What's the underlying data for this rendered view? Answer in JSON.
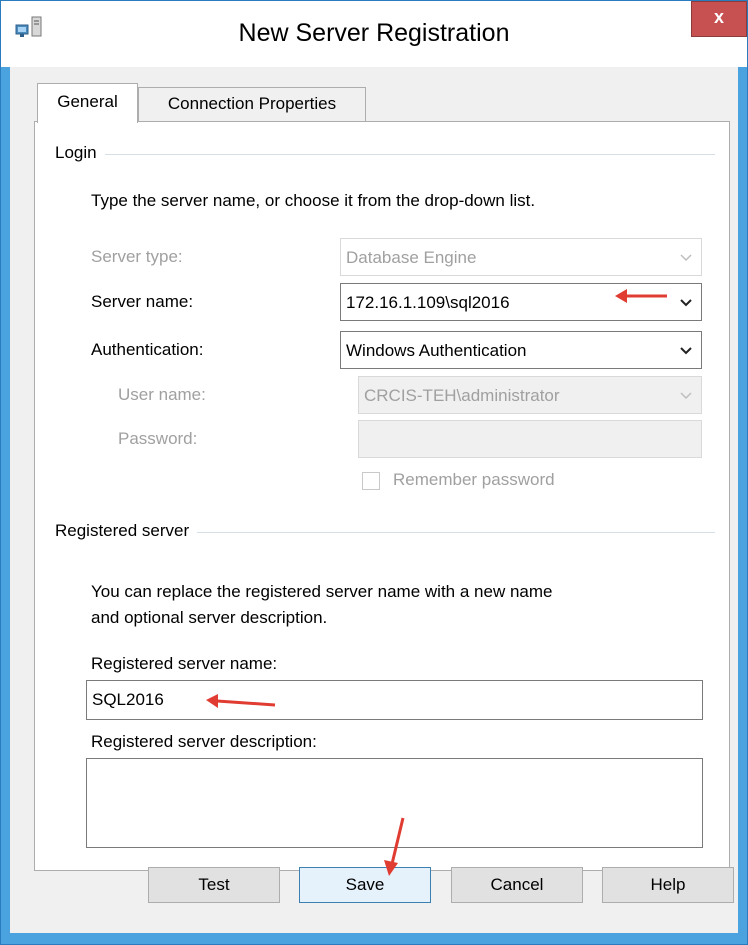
{
  "window": {
    "title": "New Server Registration",
    "close_label": "x",
    "icon": "server-registration-icon"
  },
  "tabs": [
    {
      "label": "General",
      "selected": true
    },
    {
      "label": "Connection Properties",
      "selected": false
    }
  ],
  "login": {
    "group_label": "Login",
    "instruction": "Type the server name, or choose it from the drop-down list.",
    "server_type": {
      "label": "Server type:",
      "value": "Database Engine",
      "enabled": false
    },
    "server_name": {
      "label": "Server name:",
      "value": "172.16.1.109\\sql2016",
      "enabled": true
    },
    "authentication": {
      "label": "Authentication:",
      "value": "Windows Authentication",
      "enabled": true
    },
    "user_name": {
      "label": "User name:",
      "value": "CRCIS-TEH\\administrator",
      "enabled": false
    },
    "password": {
      "label": "Password:",
      "value": "",
      "enabled": false
    },
    "remember_password": {
      "label": "Remember password",
      "checked": false,
      "enabled": false
    }
  },
  "registered": {
    "group_label": "Registered server",
    "instruction_line1": "You can replace the registered server name with a new name",
    "instruction_line2": "and optional server description.",
    "name_label": "Registered server name:",
    "name_value": "SQL2016",
    "description_label": "Registered server description:",
    "description_value": ""
  },
  "buttons": {
    "test": "Test",
    "save": "Save",
    "cancel": "Cancel",
    "help": "Help"
  },
  "annotations": {
    "arrow_color": "#e03c31",
    "targets": [
      "server-name-combo",
      "registered-server-name-input",
      "save-button"
    ]
  }
}
